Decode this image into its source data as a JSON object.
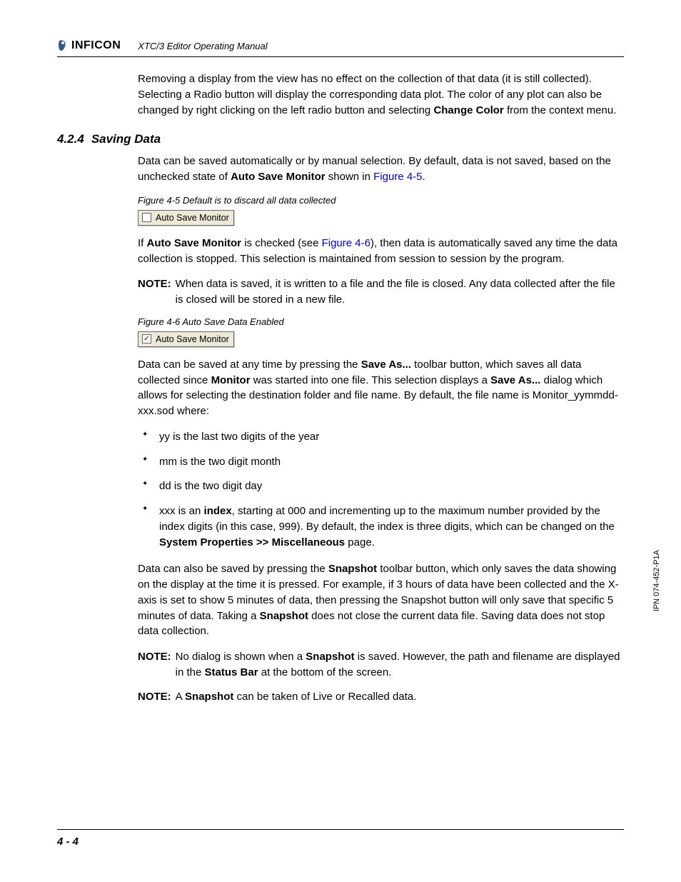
{
  "header": {
    "logo_text": "INFICON",
    "title": "XTC/3 Editor Operating Manual"
  },
  "intro_para": {
    "t1": "Removing a display from the view has no effect on the collection of that data (it is still collected). Selecting a Radio button will display the corresponding data plot. The color of any plot can also be changed by right clicking on the left radio button and selecting ",
    "b1": "Change Color",
    "t2": " from the context menu."
  },
  "section": {
    "number": "4.2.4",
    "title": "Saving Data"
  },
  "p1": {
    "t1": "Data can be saved automatically or by manual selection. By default, data is not saved, based on the unchecked state of ",
    "b1": "Auto Save Monitor",
    "t2": " shown in ",
    "l1": "Figure 4-5",
    "t3": "."
  },
  "fig45": {
    "caption": "Figure 4-5  Default is to discard all data collected",
    "label": "Auto Save Monitor",
    "checked": false
  },
  "p2": {
    "t1": "If ",
    "b1": "Auto Save Monitor",
    "t2": " is checked (see ",
    "l1": "Figure 4-6",
    "t3": "), then data is automatically saved any time the data collection is stopped. This selection is maintained from session to session by the program."
  },
  "note1": {
    "label": "NOTE:",
    "text": "When data is saved, it is written to a file and the file is closed. Any data collected after the file is closed will be stored in a new file."
  },
  "fig46": {
    "caption": "Figure 4-6  Auto Save Data Enabled",
    "label": "Auto Save Monitor",
    "checked": true
  },
  "p3": {
    "t1": "Data can be saved at any time by pressing the ",
    "b1": "Save As...",
    "t2": " toolbar button, which saves all data collected since ",
    "b2": "Monitor",
    "t3": " was started into one file. This selection displays a ",
    "b3": "Save As...",
    "t4": " dialog which allows for selecting the destination folder and file name. By default, the file name is Monitor_yymmdd-xxx.sod where:"
  },
  "bullets": {
    "b1": "yy is the last two digits of the year",
    "b2": "mm is the two digit month",
    "b3": "dd is the two digit day",
    "b4": {
      "t1": "xxx is an ",
      "bd1": "index",
      "t2": ", starting at 000 and incrementing up to the maximum number provided by the index digits (in this case, 999). By default, the index is three digits, which can be changed on the ",
      "bd2": "System Properties >> Miscellaneous",
      "t3": " page."
    }
  },
  "p4": {
    "t1": "Data can also be saved by pressing the ",
    "b1": "Snapshot",
    "t2": " toolbar button, which only saves the data showing on the display at the time it is pressed. For example, if 3 hours of data have been collected and the X-axis is set to show 5 minutes of data, then pressing the Snapshot button will only save that specific 5 minutes of data. Taking a ",
    "b2": "Snapshot",
    "t3": " does not close the current data file. Saving data does not stop data collection."
  },
  "note2": {
    "label": "NOTE:",
    "t1": "No dialog is shown when a ",
    "b1": "Snapshot",
    "t2": " is saved. However, the path and filename are displayed in the ",
    "b2": "Status Bar",
    "t3": " at the bottom of the screen."
  },
  "note3": {
    "label": "NOTE:",
    "t1": "A ",
    "b1": "Snapshot",
    "t2": " can be taken of Live or Recalled data."
  },
  "footer": {
    "page": "4 - 4"
  },
  "side_id": "IPN 074-452-P1A"
}
